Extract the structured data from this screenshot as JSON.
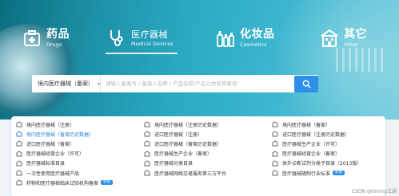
{
  "nav": {
    "items": [
      {
        "cn": "药品",
        "en": "Drugs",
        "icon": "medicine-box-icon"
      },
      {
        "cn": "医疗器械",
        "en": "Medical Devices",
        "icon": "stethoscope-icon"
      },
      {
        "cn": "化妆品",
        "en": "Cosmetics",
        "icon": "cosmetics-bottle-icon"
      },
      {
        "cn": "其它",
        "en": "Other",
        "icon": "building-icon"
      }
    ],
    "active": "医疗器械"
  },
  "search": {
    "category": "境内医疗器械（备案）",
    "placeholder": "请输入备案号 / 备案人名称 / 产品名称/产品分类名称查询"
  },
  "links": [
    {
      "label": "境内医疗器械（注册）",
      "hl": false
    },
    {
      "label": "境内医疗器械（注册历史数据）",
      "hl": false
    },
    {
      "label": "境内医疗器械（备案）",
      "hl": false
    },
    {
      "label": "境内医疗器械（备案历史数据）",
      "hl": true
    },
    {
      "label": "进口医疗器械（注册）",
      "hl": false
    },
    {
      "label": "进口医疗器械（注册历史数据）",
      "hl": false
    },
    {
      "label": "进口医疗器械（备案）",
      "hl": false
    },
    {
      "label": "进口医疗器械（备案历史数据）",
      "hl": false
    },
    {
      "label": "医疗器械生产企业（许可）",
      "hl": false
    },
    {
      "label": "医疗器械经营企业（许可）",
      "hl": false
    },
    {
      "label": "医疗器械生产企业（备案）",
      "hl": false
    },
    {
      "label": "医疗器械经营企业（备案）",
      "hl": false
    },
    {
      "label": "医疗器械标准目录",
      "hl": false
    },
    {
      "label": "医疗器械分类目录",
      "hl": false
    },
    {
      "label": "体外诊断试剂分类子目录（2013版）",
      "hl": false
    },
    {
      "label": "一次性使用医疗器械产品",
      "hl": false
    },
    {
      "label": "医疗器械网络交易服务第三方平台",
      "hl": false
    },
    {
      "label": "医疗器械随制行业标准",
      "hl": false,
      "badge": "新版"
    },
    {
      "label": "药物和医疗器械临床试验机构备案",
      "hl": false,
      "badge": "新版"
    }
  ],
  "watermark": "CSDN @timing江湖",
  "colors": {
    "accent": "#2e8fea",
    "hero": "#2aa9c2"
  }
}
